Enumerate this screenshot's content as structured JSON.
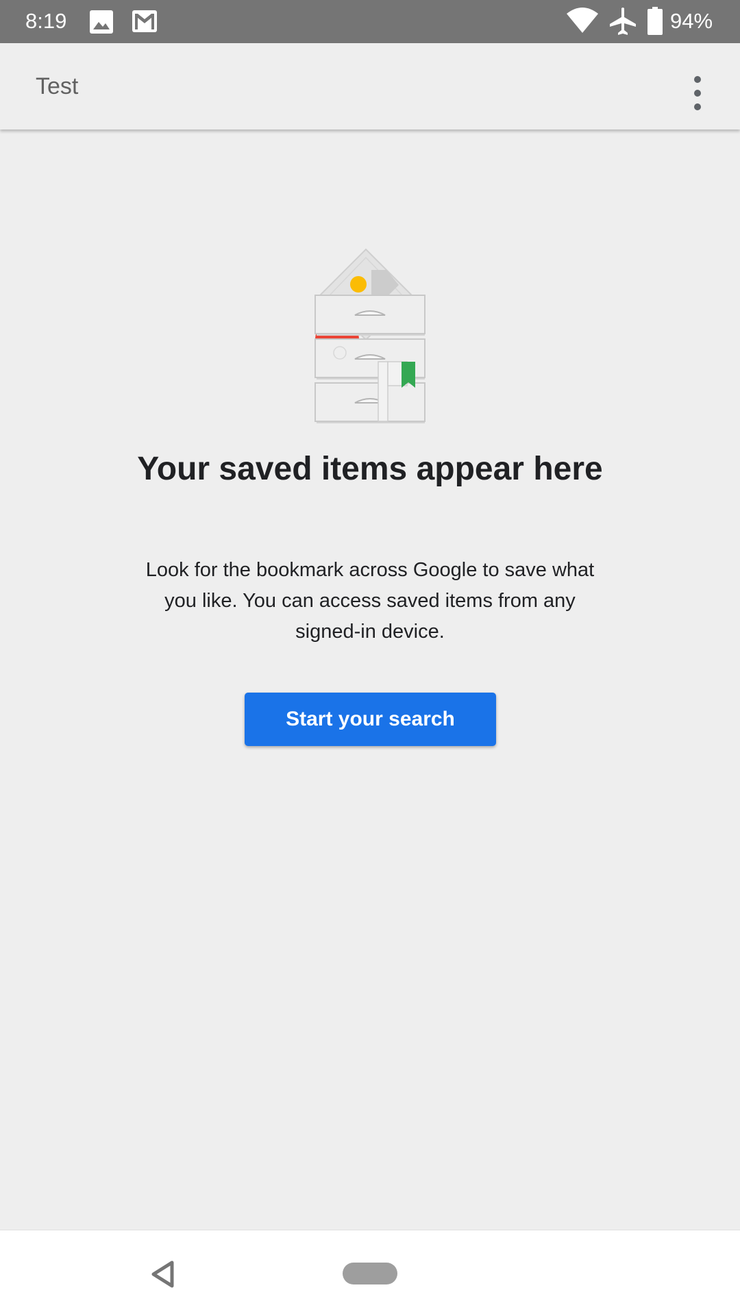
{
  "status_bar": {
    "time": "8:19",
    "battery": "94%",
    "left_icons": [
      "image-icon",
      "gmail-icon"
    ],
    "right_icons": [
      "wifi-icon",
      "airplane-icon",
      "battery-icon"
    ]
  },
  "app_bar": {
    "title": "Test",
    "menu_icon": "more-vert-icon"
  },
  "empty_state": {
    "illustration": "saved-items-drawers-illustration",
    "heading": "Your saved items appear here",
    "description": "Look for the bookmark across Google to save what you like. You can access saved items from any signed-in device.",
    "button_label": "Start your search"
  },
  "nav_bar": {
    "back_icon": "back-triangle-icon",
    "home_icon": "home-pill-icon"
  },
  "colors": {
    "status_bar": "#757575",
    "background": "#eeeeee",
    "button": "#1a73e8",
    "heading_text": "#202124",
    "bookmark_green": "#34a853",
    "accent_red": "#ea4335",
    "accent_yellow": "#fbbc04"
  }
}
